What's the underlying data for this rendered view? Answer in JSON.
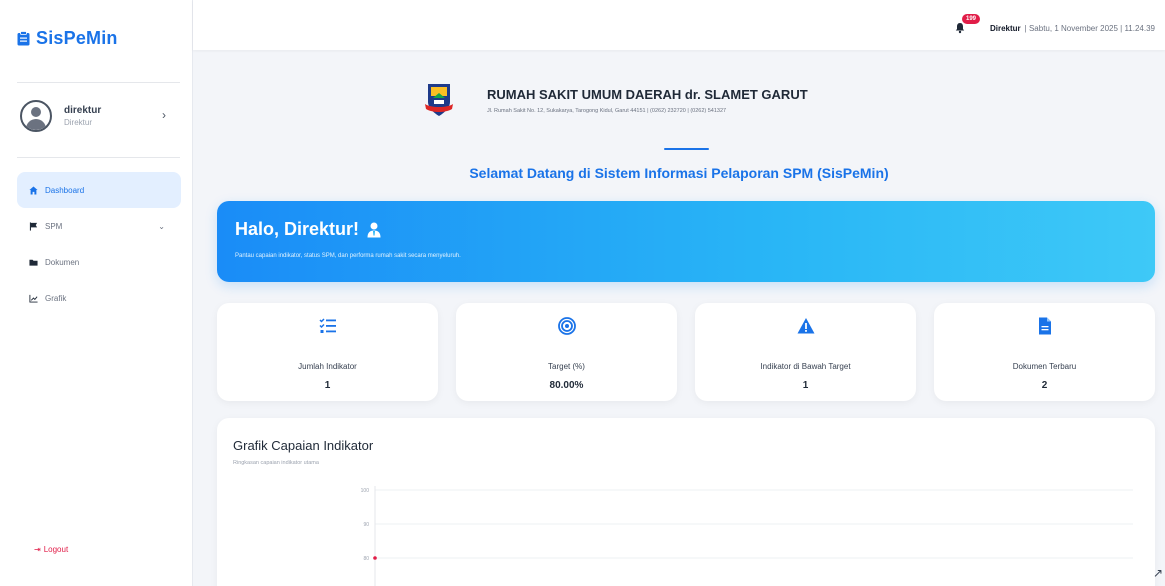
{
  "app": {
    "brand": "SisPeMin"
  },
  "user": {
    "name": "direktur",
    "role": "Direktur"
  },
  "nav": {
    "items": [
      {
        "label": "Dashboard",
        "icon": "home-icon"
      },
      {
        "label": "SPM",
        "icon": "flag-icon"
      },
      {
        "label": "Dokumen",
        "icon": "folder-icon"
      },
      {
        "label": "Grafik",
        "icon": "chart-icon"
      }
    ],
    "logout": "Logout"
  },
  "topbar": {
    "notif_count": "199",
    "user_label": "Direktur",
    "datetime": "| Sabtu, 1 November 2025 | 11.24.39"
  },
  "hospital": {
    "name": "RUMAH SAKIT UMUM DAERAH dr. SLAMET GARUT",
    "address": "Jl. Rumah Sakit No. 12, Sukakarya, Tarogong Kidul, Garut 44151 | (0262) 232720 | (0262) 541327"
  },
  "welcome": "Selamat Datang di Sistem Informasi Pelaporan SPM (SisPeMin)",
  "hero": {
    "title": "Halo, Direktur!",
    "subtitle": "Pantau capaian indikator, status SPM, dan performa rumah sakit secara menyeluruh."
  },
  "cards": [
    {
      "label": "Jumlah Indikator",
      "value": "1",
      "icon": "list-check-icon",
      "color": "#1a73e8"
    },
    {
      "label": "Target (%)",
      "value": "80.00%",
      "icon": "target-icon",
      "color": "#1a73e8"
    },
    {
      "label": "Indikator di Bawah Target",
      "value": "1",
      "icon": "warning-icon",
      "color": "#1a73e8"
    },
    {
      "label": "Dokumen Terbaru",
      "value": "2",
      "icon": "document-icon",
      "color": "#1a73e8"
    }
  ],
  "chart": {
    "title": "Grafik Capaian Indikator",
    "subtitle": "Ringkasan capaian indikator utama"
  },
  "chart_data": {
    "type": "line",
    "title": "Grafik Capaian Indikator",
    "ylim": [
      0,
      100
    ],
    "yticks": [
      "100",
      "90",
      "80"
    ],
    "series": [
      {
        "values": [
          80
        ]
      }
    ],
    "grid": true
  },
  "colors": {
    "accent": "#1a73e8",
    "danger": "#e11d48"
  }
}
